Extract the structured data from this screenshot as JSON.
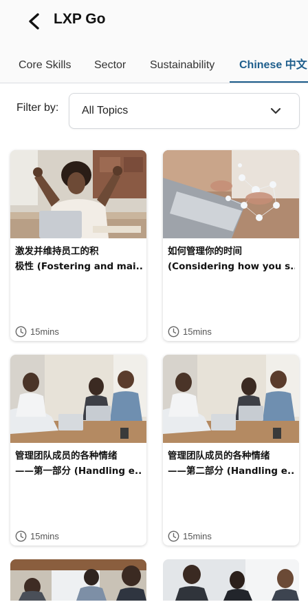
{
  "header": {
    "title": "LXP Go"
  },
  "tabs": [
    {
      "label": "Core Skills",
      "active": false
    },
    {
      "label": "Sector",
      "active": false
    },
    {
      "label": "Sustainability",
      "active": false
    },
    {
      "label": "Chinese 中文",
      "active": true
    }
  ],
  "filter": {
    "label": "Filter by:",
    "value": "All Topics"
  },
  "courses": [
    {
      "title_line1": "激发并维持员工的积",
      "title_line2": "极性 (Fostering and mai...",
      "duration": "15mins",
      "image": "celebrating-woman-photo"
    },
    {
      "title_line1": "如何管理你的时间",
      "title_line2": "(Considering how you s...",
      "duration": "15mins",
      "image": "laptop-network-photo"
    },
    {
      "title_line1": "管理团队成员的各种情绪",
      "title_line2": "——第一部分 (Handling e...",
      "duration": "15mins",
      "image": "team-meeting-photo"
    },
    {
      "title_line1": "管理团队成员的各种情绪",
      "title_line2": "——第二部分 (Handling e...",
      "duration": "15mins",
      "image": "team-meeting-photo"
    }
  ],
  "colors": {
    "accent": "#1e5e8c",
    "text": "#111111",
    "muted": "#555555"
  }
}
